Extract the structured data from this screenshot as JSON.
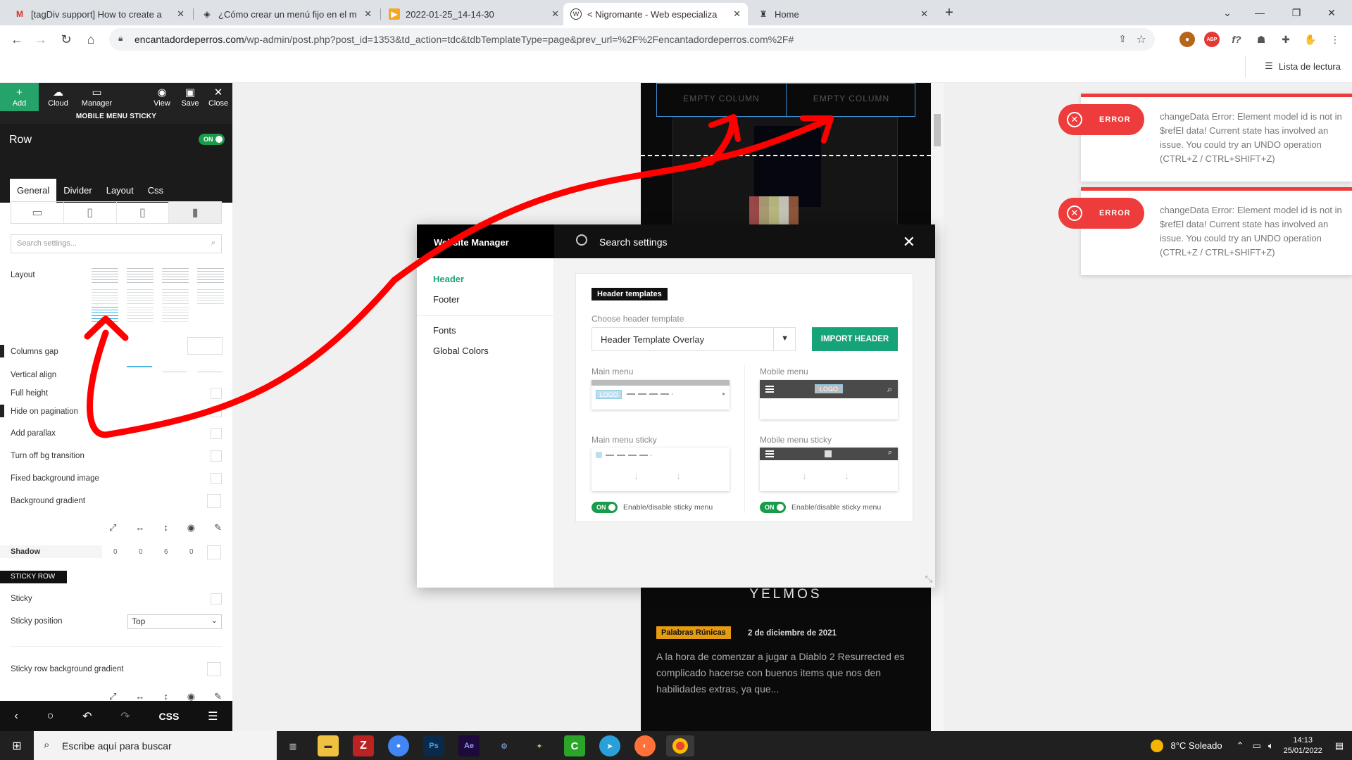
{
  "browser": {
    "tabs": [
      {
        "title": "[tagDiv support] How to create a",
        "icon": "gmail-icon",
        "active": false
      },
      {
        "title": "¿Cómo crear un menú fijo en el m",
        "icon": "site-icon",
        "active": false
      },
      {
        "title": "2022-01-25_14-14-30",
        "icon": "video-icon",
        "active": false
      },
      {
        "title": "< Nigromante - Web especializa",
        "icon": "wordpress-icon",
        "active": true
      },
      {
        "title": "Home",
        "icon": "page-icon",
        "active": false
      }
    ],
    "url_host": "encantadordeperros.com",
    "url_path": "/wp-admin/post.php?post_id=1353&td_action=tdc&tdbTemplateType=page&prev_url=%2F%2Fencantadordeperros.com%2F#",
    "reading_list": "Lista de lectura"
  },
  "panel": {
    "toolbar": {
      "add": "Add",
      "cloud": "Cloud",
      "manager": "Manager",
      "view": "View",
      "save": "Save",
      "close": "Close"
    },
    "title": "MOBILE MENU STICKY",
    "row_label": "Row",
    "toggle": "ON",
    "tabs": [
      "General",
      "Divider",
      "Layout",
      "Css"
    ],
    "search_placeholder": "Search settings...",
    "layout": "Layout",
    "columns_gap": "Columns gap",
    "vertical_align": "Vertical align",
    "full_height": "Full height",
    "hide_pagination": "Hide on pagination",
    "add_parallax": "Add parallax",
    "turn_off_bg": "Turn off bg transition",
    "fixed_bg": "Fixed background image",
    "bg_gradient": "Background gradient",
    "shadow": "Shadow",
    "shadow_values": [
      "0",
      "0",
      "6",
      "0"
    ],
    "sticky_row": "STICKY ROW",
    "sticky": "Sticky",
    "sticky_position": "Sticky position",
    "sticky_position_value": "Top",
    "sticky_row_gradient": "Sticky row background gradient",
    "bottom_css": "CSS"
  },
  "preview": {
    "empty_col_1": "EMPTY COLUMN",
    "empty_col_2": "EMPTY COLUMN",
    "heading": "YELMOS",
    "tag": "Palabras Rúnicas",
    "date": "2 de diciembre de 2021",
    "excerpt": "A la hora de comenzar a jugar a Diablo 2 Resurrected es complicado hacerse con buenos items que nos den habilidades extras, ya que..."
  },
  "modal": {
    "title": "Website Manager",
    "search": "Search settings",
    "nav": {
      "header": "Header",
      "footer": "Footer",
      "fonts": "Fonts",
      "colors": "Global Colors"
    },
    "section_tag": "Header templates",
    "choose_label": "Choose header template",
    "template_value": "Header Template Overlay",
    "import_button": "IMPORT HEADER",
    "main_menu": "Main menu",
    "mobile_menu": "Mobile menu",
    "main_menu_sticky": "Main menu sticky",
    "mobile_menu_sticky": "Mobile menu sticky",
    "logo": "LOGO",
    "toggle_on": "ON",
    "enable_sticky": "Enable/disable sticky menu"
  },
  "errors": [
    {
      "label": "ERROR",
      "message": "changeData Error: Element model id is not in $refEl data! Current state has involved an issue. You could try an UNDO operation (CTRL+Z / CTRL+SHIFT+Z)"
    },
    {
      "label": "ERROR",
      "message": "changeData Error: Element model id is not in $refEl data! Current state has involved an issue. You could try an UNDO operation (CTRL+Z / CTRL+SHIFT+Z)"
    }
  ],
  "taskbar": {
    "search_placeholder": "Escribe aquí para buscar",
    "weather": "8°C  Soleado",
    "time": "14:13",
    "date": "25/01/2022"
  },
  "colors": {
    "accent_green": "#17a37a",
    "error_red": "#ee3b3b",
    "annotation_red": "#ff0000"
  }
}
